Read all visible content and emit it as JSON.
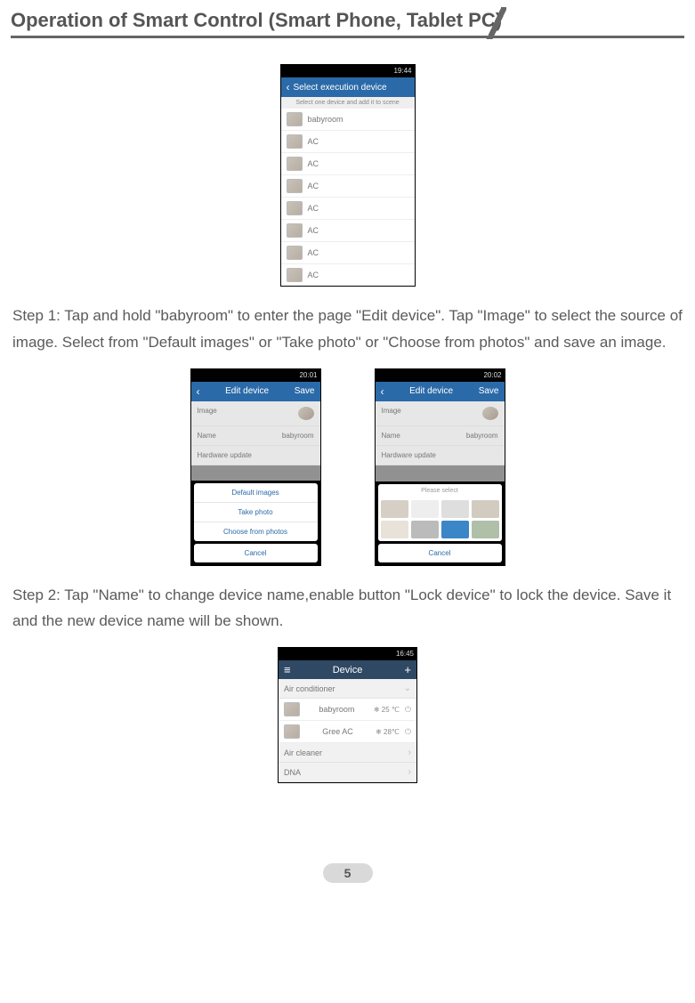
{
  "header": {
    "title": "Operation of Smart Control (Smart Phone, Tablet PC)"
  },
  "text": {
    "step1": "Step 1: Tap and hold \"babyroom\" to enter the page \"Edit device\". Tap \"Image\" to select the source of image. Select from \"Default images\" or \"Take photo\" or \"Choose from photos\" and save an image.",
    "step2": "Step 2: Tap \"Name\" to change device name,enable button \"Lock device\" to lock the device. Save it and the new device name will be shown."
  },
  "fig1": {
    "time": "19:44",
    "title": "Select execution device",
    "hint": "Select one device and add it to scene",
    "rows": [
      "babyroom",
      "AC",
      "AC",
      "AC",
      "AC",
      "AC",
      "AC",
      "AC"
    ]
  },
  "fig2a": {
    "time": "20:01",
    "title": "Edit device",
    "save": "Save",
    "labels": {
      "image": "Image",
      "name": "Name",
      "name_value": "babyroom",
      "hw": "Hardware update"
    },
    "options": [
      "Default images",
      "Take photo",
      "Choose from photos"
    ],
    "cancel": "Cancel"
  },
  "fig2b": {
    "time": "20:02",
    "title": "Edit device",
    "save": "Save",
    "labels": {
      "image": "Image",
      "name": "Name",
      "name_value": "babyroom",
      "hw": "Hardware update"
    },
    "please": "Please select",
    "cancel": "Cancel"
  },
  "fig3": {
    "time": "16:45",
    "title": "Device",
    "section1": "Air conditioner",
    "rows": [
      {
        "name": "babyroom",
        "temp": "❄ 25 ℃"
      },
      {
        "name": "Gree AC",
        "temp": "❄ 28℃"
      }
    ],
    "more": [
      "Air cleaner",
      "DNA"
    ]
  },
  "page_number": "5"
}
